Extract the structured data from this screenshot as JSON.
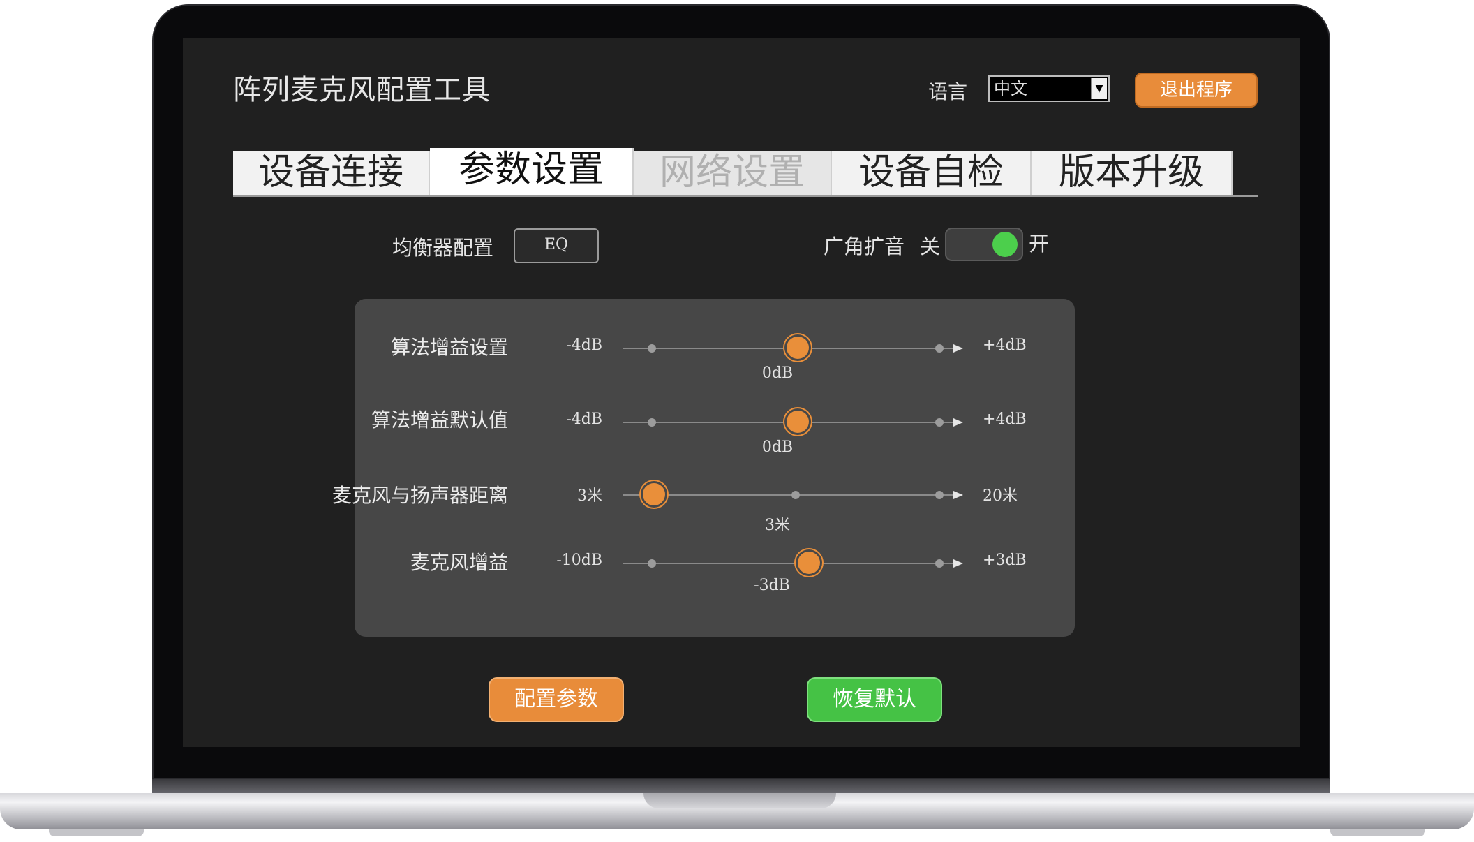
{
  "app": {
    "title": "阵列麦克风配置工具",
    "language_label": "语言",
    "language_value": "中文",
    "exit_label": "退出程序"
  },
  "tabs": [
    {
      "label": "设备连接",
      "state": "normal"
    },
    {
      "label": "参数设置",
      "state": "active"
    },
    {
      "label": "网络设置",
      "state": "disabled"
    },
    {
      "label": "设备自检",
      "state": "normal"
    },
    {
      "label": "版本升级",
      "state": "normal"
    }
  ],
  "settings": {
    "eq_label": "均衡器配置",
    "eq_button": "EQ",
    "wide_label": "广角扩音",
    "off_label": "关",
    "on_label": "开",
    "wide_enabled": true
  },
  "sliders": [
    {
      "label": "算法增益设置",
      "min": "-4dB",
      "max": "+4dB",
      "value": "0dB",
      "position": 0.5
    },
    {
      "label": "算法增益默认值",
      "min": "-4dB",
      "max": "+4dB",
      "value": "0dB",
      "position": 0.5
    },
    {
      "label": "麦克风与扬声器距离",
      "min": "3米",
      "max": "20米",
      "value": "3米",
      "position": 0.0
    },
    {
      "label": "麦克风增益",
      "min": "-10dB",
      "max": "+3dB",
      "value": "-3dB",
      "position": 0.54
    }
  ],
  "buttons": {
    "config": "配置参数",
    "restore": "恢复默认"
  },
  "colors": {
    "accent": "#e88c3a",
    "success": "#45c245",
    "screen_bg": "#202020",
    "panel_bg": "#474747"
  },
  "icons": {
    "dropdown": "chevron-down-icon",
    "slider_end": "arrow-right-icon"
  }
}
